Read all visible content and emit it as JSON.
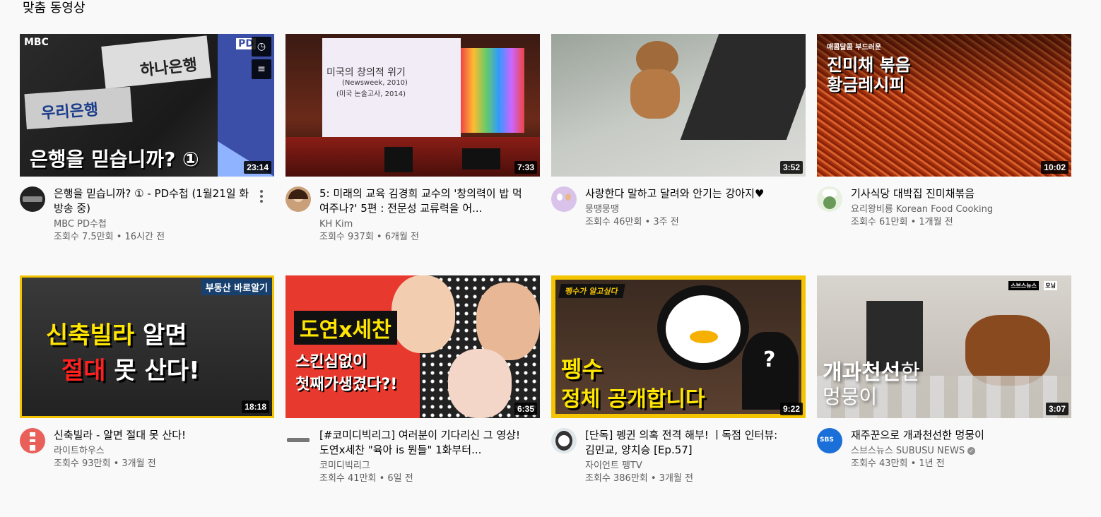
{
  "section_title": "맞춤 동영상",
  "videos": [
    {
      "title": "은행을 믿습니까? ① - PD수첩 (1월21일 화 방송 중)",
      "channel": "MBC PD수첩",
      "stats": "조회수 7.5만회 • 16시간 전",
      "duration": "23:14",
      "thumb_text": {
        "logo": "MBC",
        "line1": "하나은행",
        "line2": "우리은행",
        "main": "은행을 믿습니까? ①",
        "badge": "PD"
      }
    },
    {
      "title": "5: 미래의 교육 김경희 교수의 '창의력이 밥 먹여주나?' 5편 : 전문성 교류력을 어...",
      "channel": "KH Kim",
      "stats": "조회수 937회 • 6개월 전",
      "duration": "7:33",
      "thumb_text": {
        "slide1": "미국의 창의적 위기",
        "slide2": "(Newsweek, 2010)",
        "slide3": "(미국 논술고사, 2014)"
      }
    },
    {
      "title": "사랑한다 말하고 달려와 안기는 강아지♥",
      "channel": "뭉땡뭉땡",
      "stats": "조회수 46만회 • 3주 전",
      "duration": "3:52"
    },
    {
      "title": "기사식당 대박집 진미채볶음",
      "channel": "요리왕비룡 Korean Food Cooking",
      "stats": "조회수 61만회 • 1개월 전",
      "duration": "10:02",
      "thumb_text": {
        "small": "매콤달콤 부드러운",
        "l1": "진미채 볶음",
        "l2": "황금레시피"
      }
    },
    {
      "title": "신축빌라 - 알면 절대 못 산다!",
      "channel": "라이트하우스",
      "stats": "조회수 93만회 • 3개월 전",
      "duration": "18:18",
      "thumb_text": {
        "badge": "부동산 바로알기",
        "l1a": "신축빌라",
        "l1b": " 알면",
        "l2a": "절대",
        "l2b": " 못 산다!"
      }
    },
    {
      "title": "[#코미디빅리그] 여러분이 기다리신 그 영상! 도연x세찬 \"육아 is 뭔들\" 1화부터...",
      "channel": "코미디빅리그",
      "stats": "조회수 41만회 • 6일 전",
      "duration": "6:35",
      "thumb_text": {
        "l1": "도연x세찬",
        "l2": "스킨십없이",
        "l3": "첫째가생겼다?!"
      }
    },
    {
      "title": "[단독] 펭귄 의혹 전격 해부! ㅣ독점 인터뷰: 김민교, 양치승 [Ep.57]",
      "channel": "자이언트 펭TV",
      "stats": "조회수 386만회 • 3개월 전",
      "duration": "9:22",
      "thumb_text": {
        "banner": "펭수가 알고싶다",
        "l1": "펭수",
        "l2": "정체 공개합니다",
        "q": "?"
      }
    },
    {
      "title": "재주꾼으로 개과천선한 멍뭉이",
      "channel": "스브스뉴스 SUBUSU NEWS",
      "stats": "조회수 43만회 • 1년 전",
      "duration": "3:07",
      "thumb_text": {
        "l1a": "개과천선",
        "l1b": "한",
        "l2": "멍뭉이",
        "logo": "스브스뉴스",
        "logo2": "모닝"
      }
    }
  ]
}
